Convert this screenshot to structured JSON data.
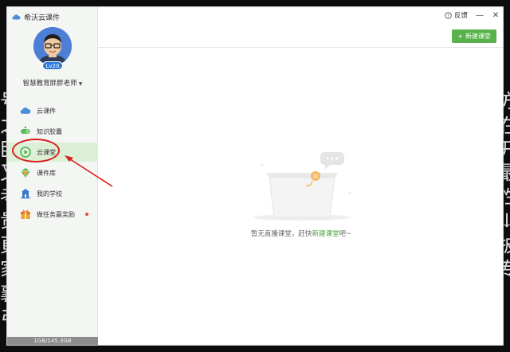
{
  "app": {
    "title": "希沃云课件"
  },
  "background": {
    "glyphs": [
      "号",
      "之",
      "卧",
      "又",
      "考",
      "贵",
      "頁",
      "家",
      "襄",
      "弓",
      "方",
      "在",
      "开",
      "最",
      "性",
      "↓",
      "披",
      "专"
    ]
  },
  "profile": {
    "name": "智慧教育胖胖老师",
    "level": "Lv20"
  },
  "sidebar": {
    "items": [
      {
        "label": "云课件",
        "icon": "cloud-icon",
        "color": "#4a90d9"
      },
      {
        "label": "知识胶囊",
        "icon": "capsule-icon",
        "color": "#5cb85c"
      },
      {
        "label": "云课堂",
        "icon": "play-circle-icon",
        "color": "#4caf50",
        "active": true
      },
      {
        "label": "课件库",
        "icon": "library-icon",
        "color": "#5cb85c"
      },
      {
        "label": "我的学校",
        "icon": "school-icon",
        "color": "#3a78c9"
      },
      {
        "label": "做任务赢奖励",
        "icon": "gift-icon",
        "color": "#f0a030",
        "badge_dot": true
      }
    ],
    "storage": "1GB/145.3GB"
  },
  "header": {
    "feedback_label": "反馈",
    "minimize": "—",
    "close": "✕",
    "new_button_label": "新建课堂"
  },
  "empty_state": {
    "text_before": "暂无直播课堂，赶快",
    "link_text": "新建课堂",
    "text_after": "吧~"
  },
  "colors": {
    "accent": "#58b24a",
    "active_bg": "#dcf0d6",
    "annotation": "#d81e1e"
  }
}
